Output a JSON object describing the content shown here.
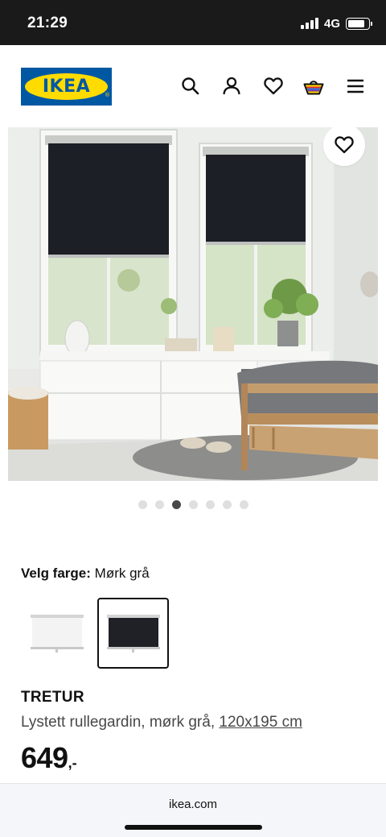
{
  "status_bar": {
    "time": "21:29",
    "network": "4G",
    "battery_level": 0.85
  },
  "header": {
    "logo_text": "IKEA",
    "logo_registered": "®",
    "icons": [
      "search-icon",
      "user-icon",
      "heart-icon",
      "shopping-bag-icon",
      "menu-icon"
    ]
  },
  "gallery": {
    "image_count": 7,
    "active_index": 2,
    "favourite_icon": "heart-icon"
  },
  "color_selection": {
    "label": "Velg farge:",
    "selected": "Mørk grå",
    "options": [
      {
        "name": "white",
        "color": "#f3f3f3",
        "selected": false
      },
      {
        "name": "dark-grey",
        "color": "#1f2127",
        "selected": true
      }
    ]
  },
  "product": {
    "name": "TRETUR",
    "description": "Lystett rullegardin, mørk grå, ",
    "size": "120x195 cm",
    "price_integer": "649",
    "price_suffix": ",-"
  },
  "browser": {
    "url": "ikea.com"
  },
  "colors": {
    "ikea_blue": "#0058a3",
    "ikea_yellow": "#ffdb00",
    "status_bar": "#1a1a1a"
  }
}
